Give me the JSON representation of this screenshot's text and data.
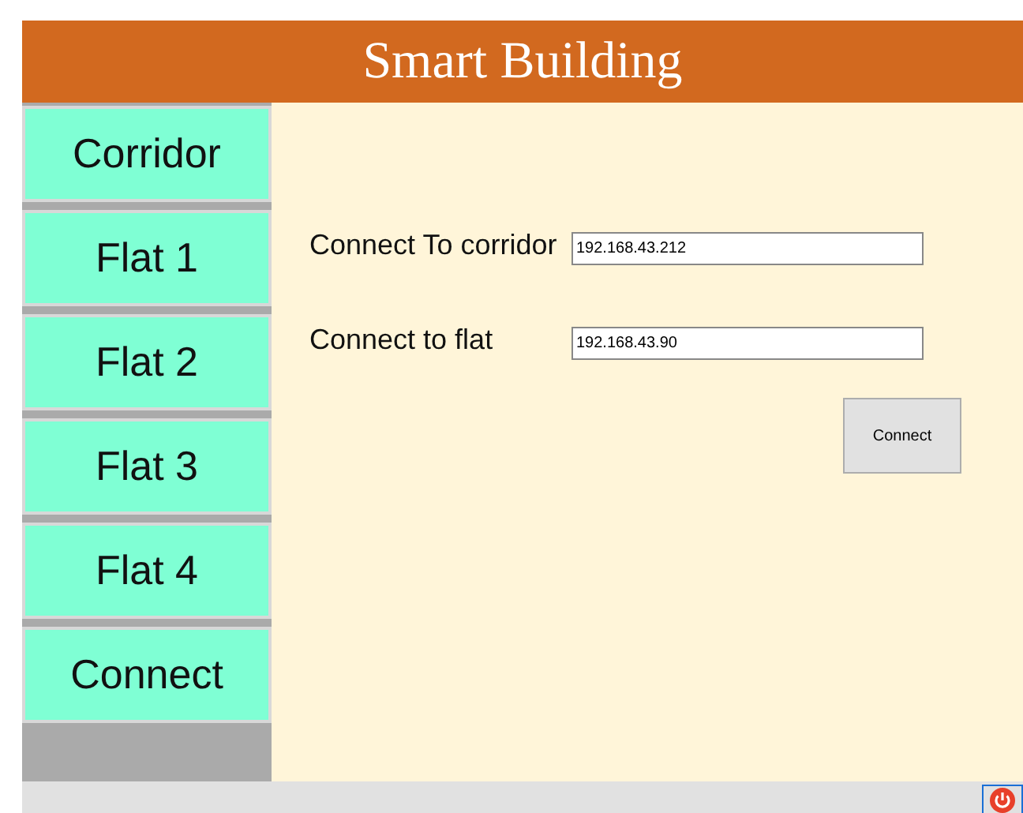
{
  "window": {
    "title": "Smart Building"
  },
  "sidebar": {
    "items": [
      {
        "label": "Corridor"
      },
      {
        "label": "Flat 1"
      },
      {
        "label": "Flat 2"
      },
      {
        "label": "Flat 3"
      },
      {
        "label": "Flat 4"
      },
      {
        "label": "Connect"
      }
    ]
  },
  "form": {
    "fields": [
      {
        "label": "Connect To corridor",
        "value": "192.168.43.212"
      },
      {
        "label": "Connect to flat",
        "value": "192.168.43.90"
      }
    ],
    "button": "Connect"
  }
}
